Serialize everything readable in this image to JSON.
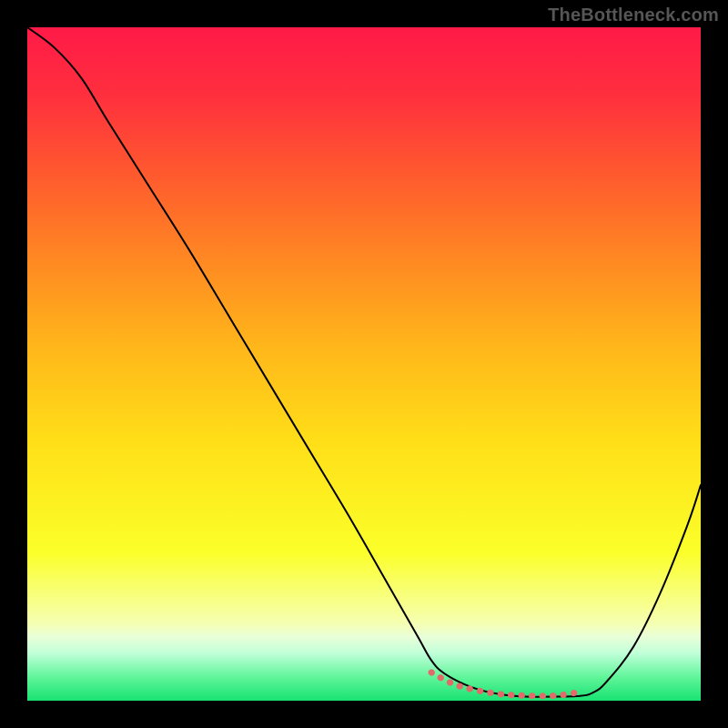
{
  "attribution": "TheBottleneck.com",
  "chart_data": {
    "type": "line",
    "title": "",
    "xlabel": "",
    "ylabel": "",
    "xlim": [
      0,
      100
    ],
    "ylim": [
      0,
      100
    ],
    "background_gradient_stops": [
      {
        "t": 0.0,
        "color": "#ff1a47"
      },
      {
        "t": 0.1,
        "color": "#ff2f3e"
      },
      {
        "t": 0.22,
        "color": "#ff5a2e"
      },
      {
        "t": 0.35,
        "color": "#ff8a22"
      },
      {
        "t": 0.48,
        "color": "#ffb81a"
      },
      {
        "t": 0.62,
        "color": "#ffe018"
      },
      {
        "t": 0.78,
        "color": "#fbff2a"
      },
      {
        "t": 0.885,
        "color": "#f6ffb2"
      },
      {
        "t": 0.905,
        "color": "#e8ffd8"
      },
      {
        "t": 0.93,
        "color": "#bfffd8"
      },
      {
        "t": 0.965,
        "color": "#60f59a"
      },
      {
        "t": 1.0,
        "color": "#18e272"
      }
    ],
    "series": [
      {
        "name": "bottleneck-curve",
        "stroke": "#000000",
        "stroke_width": 2,
        "x": [
          0,
          4,
          8,
          12,
          18,
          24,
          30,
          36,
          42,
          48,
          54,
          58,
          60,
          62,
          66,
          70,
          74,
          78,
          82,
          84,
          86,
          90,
          94,
          98,
          100
        ],
        "y": [
          100,
          97,
          92.5,
          86,
          76.5,
          67,
          57,
          47,
          37,
          27,
          16.5,
          9.5,
          6,
          4,
          2,
          1,
          0.6,
          0.6,
          0.7,
          1.2,
          2.8,
          8,
          16,
          26,
          32
        ]
      },
      {
        "name": "optimal-region-marker",
        "stroke": "#e26a6a",
        "stroke_width": 7,
        "linecap": "round",
        "x": [
          60,
          63,
          66,
          70,
          73,
          76,
          79,
          82
        ],
        "y": [
          4.2,
          2.6,
          1.7,
          1.0,
          0.8,
          0.7,
          0.8,
          1.3
        ]
      }
    ]
  }
}
